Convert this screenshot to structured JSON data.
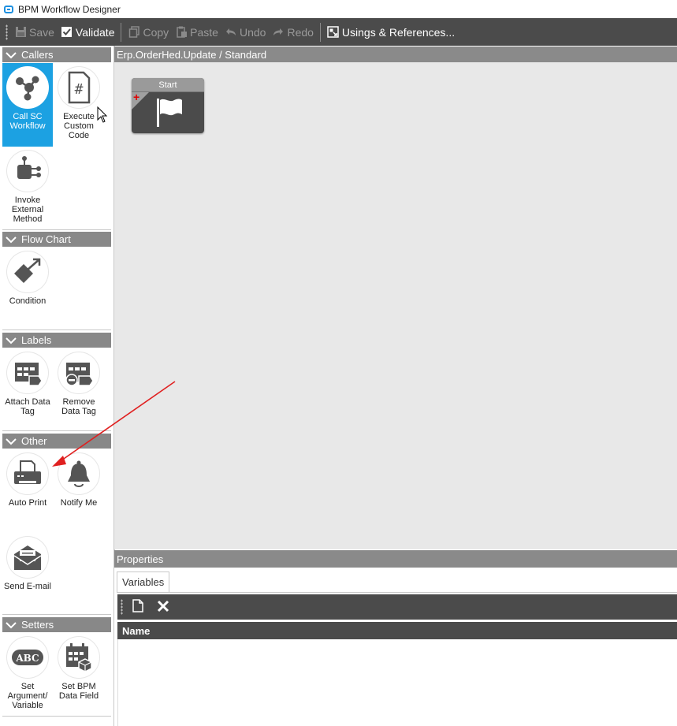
{
  "window": {
    "title": "BPM Workflow Designer",
    "app_icon": "app-window-icon"
  },
  "toolbar": {
    "save": "Save",
    "validate": "Validate",
    "copy": "Copy",
    "paste": "Paste",
    "undo": "Undo",
    "redo": "Redo",
    "usings": "Usings & References..."
  },
  "toolbox": {
    "categories": {
      "callers": "Callers",
      "flow_chart": "Flow Chart",
      "labels": "Labels",
      "other": "Other",
      "setters": "Setters"
    },
    "tools": {
      "call_sc_workflow": "Call SC Workflow",
      "execute_custom_code": "Execute Custom Code",
      "invoke_external_method": "Invoke External Method",
      "condition": "Condition",
      "attach_data_tag": "Attach Data Tag",
      "remove_data_tag": "Remove Data Tag",
      "auto_print": "Auto Print",
      "notify_me": "Notify Me",
      "send_email": "Send E-mail",
      "set_argument_variable": "Set Argument/ Variable",
      "set_bpm_data_field": "Set BPM Data Field"
    },
    "execute_code_glyph": "#",
    "abc_glyph": "ABC"
  },
  "canvas": {
    "header": "Erp.OrderHed.Update / Standard",
    "start_node": "Start",
    "background": "#e8e8e8"
  },
  "properties": {
    "header": "Properties",
    "tab": "Variables",
    "column_name": "Name"
  },
  "colors": {
    "toolbar": "#4b4b4b",
    "selected": "#1ca1e2",
    "annotation_arrow": "#e02020"
  }
}
